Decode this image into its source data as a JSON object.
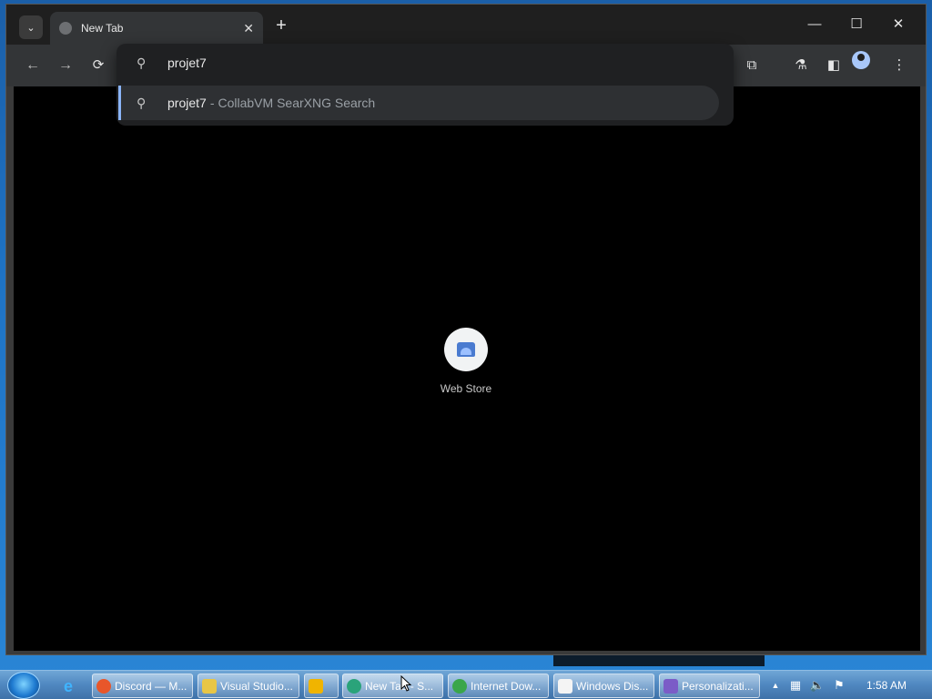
{
  "tab": {
    "title": "New Tab",
    "close": "✕"
  },
  "titlebar": {
    "tab_search": "⌄",
    "new_tab": "+",
    "minimize": "—",
    "maximize": "☐",
    "close": "✕"
  },
  "toolbar": {
    "back": "←",
    "forward": "→",
    "reload": "⟳",
    "extensions": "⧉",
    "labs": "⚗",
    "side_panel": "◧",
    "menu": "⋮"
  },
  "omnibox": {
    "input_value": "projet7",
    "suggestion_main": "projet7",
    "suggestion_sep": "-",
    "suggestion_sub": "CollabVM SearXNG Search",
    "icons": [
      "search-icon",
      "search-icon"
    ]
  },
  "shortcuts": [
    {
      "label": "Web Store",
      "icon": "web-store-icon"
    }
  ],
  "taskbar": {
    "buttons": [
      {
        "label": "Discord — M...",
        "icon_color": "#e8562a"
      },
      {
        "label": "Visual Studio...",
        "icon_color": "#e8c646"
      },
      {
        "label": "",
        "icon_color": "#f0b400"
      },
      {
        "label": "New Tab - S...",
        "icon_color": "#2aa37a"
      },
      {
        "label": "Internet Dow...",
        "icon_color": "#3aa64a"
      },
      {
        "label": "Windows Dis...",
        "icon_color": "#f4f4f4"
      },
      {
        "label": "Personalizati...",
        "icon_color": "#7b5cc7"
      }
    ],
    "tray": {
      "show_hidden": "▲",
      "network": "▦",
      "volume": "🔈",
      "flag": "⚑"
    },
    "clock": "1:58 AM"
  },
  "colors": {
    "accent": "#8ab4f8",
    "content_bg": "#000000",
    "omnibox_bg": "#1f2022"
  }
}
